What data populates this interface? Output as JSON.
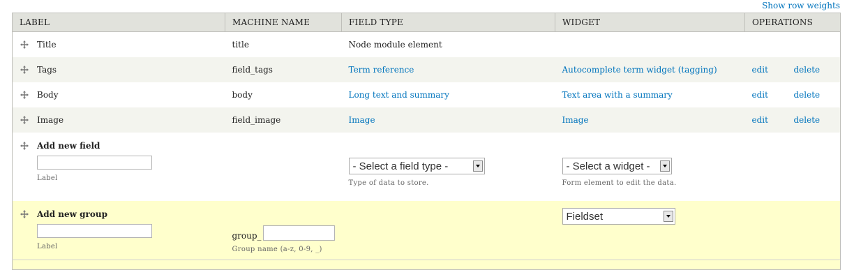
{
  "toggle_weights": "Show row weights",
  "columns": {
    "label": "LABEL",
    "machine_name": "MACHINE NAME",
    "field_type": "FIELD TYPE",
    "widget": "WIDGET",
    "operations": "OPERATIONS"
  },
  "rows": [
    {
      "label": "Title",
      "machine_name": "title",
      "field_type": "Node module element",
      "widget": "",
      "edit": "",
      "delete": ""
    },
    {
      "label": "Tags",
      "machine_name": "field_tags",
      "field_type": "Term reference",
      "widget": "Autocomplete term widget (tagging)",
      "edit": "edit",
      "delete": "delete"
    },
    {
      "label": "Body",
      "machine_name": "body",
      "field_type": "Long text and summary",
      "widget": "Text area with a summary",
      "edit": "edit",
      "delete": "delete"
    },
    {
      "label": "Image",
      "machine_name": "field_image",
      "field_type": "Image",
      "widget": "Image",
      "edit": "edit",
      "delete": "delete"
    }
  ],
  "add_field": {
    "title": "Add new field",
    "label_value": "",
    "label_desc": "Label",
    "type_select": "- Select a field type -",
    "type_desc": "Type of data to store.",
    "widget_select": "- Select a widget -",
    "widget_desc": "Form element to edit the data."
  },
  "add_group": {
    "title": "Add new group",
    "label_value": "",
    "label_desc": "Label",
    "prefix": "group_",
    "name_value": "",
    "name_desc": "Group name (a-z, 0-9, _)",
    "format_select": "Fieldset"
  }
}
